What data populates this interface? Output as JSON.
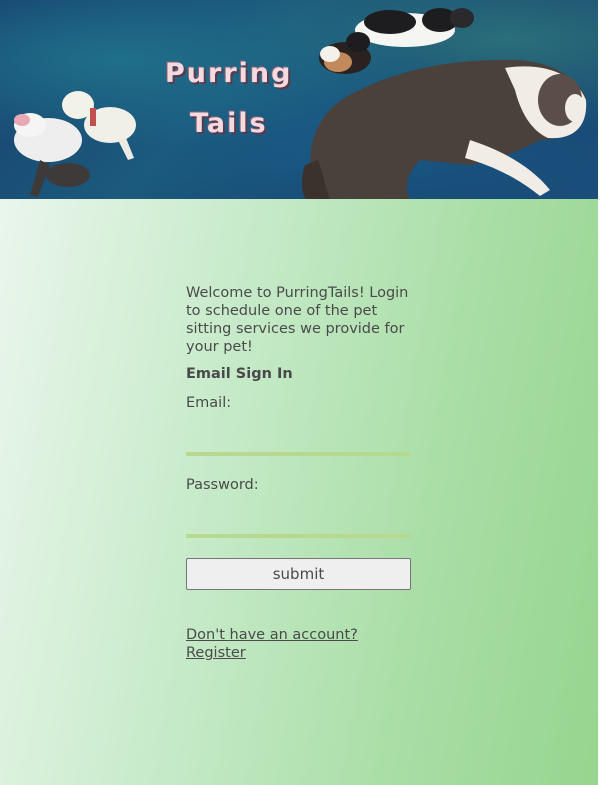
{
  "header": {
    "brand_line1": "Purring",
    "brand_line2": "Tails"
  },
  "login": {
    "welcome_text": "Welcome to PurringTails! Login to schedule one of the pet sitting services we provide for your pet!",
    "heading": "Email Sign In",
    "email_label": "Email:",
    "email_value": "",
    "password_label": "Password:",
    "password_value": "",
    "submit_label": "submit",
    "register_link": "Don't have an account? Register"
  },
  "colors": {
    "banner_bg": "#17406e",
    "content_gradient_start": "#eaf6ec",
    "content_gradient_end": "#97d58f",
    "input_underline": "#b7d98f",
    "text": "#4a4a4a"
  }
}
